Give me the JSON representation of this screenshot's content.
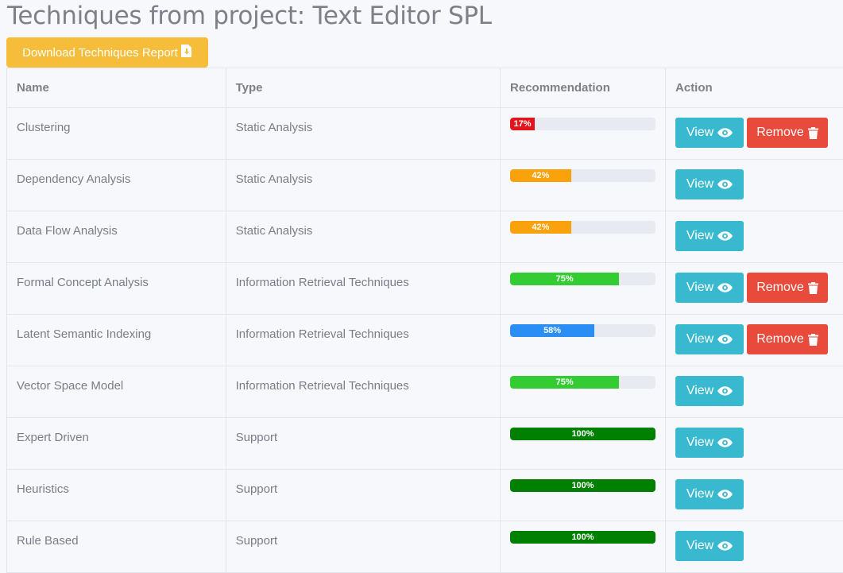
{
  "page": {
    "title": "Techniques from project: Text Editor SPL",
    "download_label": "Download Techniques Report"
  },
  "table": {
    "headers": [
      "Name",
      "Type",
      "Recommendation",
      "Action"
    ],
    "view_label": "View",
    "remove_label": "Remove",
    "rows": [
      {
        "name": "Clustering",
        "type": "Static Analysis",
        "recommendation": 17,
        "label": "17%",
        "color": "#e3141b",
        "removable": true
      },
      {
        "name": "Dependency Analysis",
        "type": "Static Analysis",
        "recommendation": 42,
        "label": "42%",
        "color": "#f9a20c",
        "removable": false
      },
      {
        "name": "Data Flow Analysis",
        "type": "Static Analysis",
        "recommendation": 42,
        "label": "42%",
        "color": "#f9a20c",
        "removable": false
      },
      {
        "name": "Formal Concept Analysis",
        "type": "Information Retrieval Techniques",
        "recommendation": 75,
        "label": "75%",
        "color": "#33cc33",
        "removable": true
      },
      {
        "name": "Latent Semantic Indexing",
        "type": "Information Retrieval Techniques",
        "recommendation": 58,
        "label": "58%",
        "color": "#2a8ef5",
        "removable": true
      },
      {
        "name": "Vector Space Model",
        "type": "Information Retrieval Techniques",
        "recommendation": 75,
        "label": "75%",
        "color": "#33cc33",
        "removable": false
      },
      {
        "name": "Expert Driven",
        "type": "Support",
        "recommendation": 100,
        "label": "100%",
        "color": "#008000",
        "removable": false
      },
      {
        "name": "Heuristics",
        "type": "Support",
        "recommendation": 100,
        "label": "100%",
        "color": "#008000",
        "removable": false
      },
      {
        "name": "Rule Based",
        "type": "Support",
        "recommendation": 100,
        "label": "100%",
        "color": "#008000",
        "removable": false
      }
    ]
  }
}
